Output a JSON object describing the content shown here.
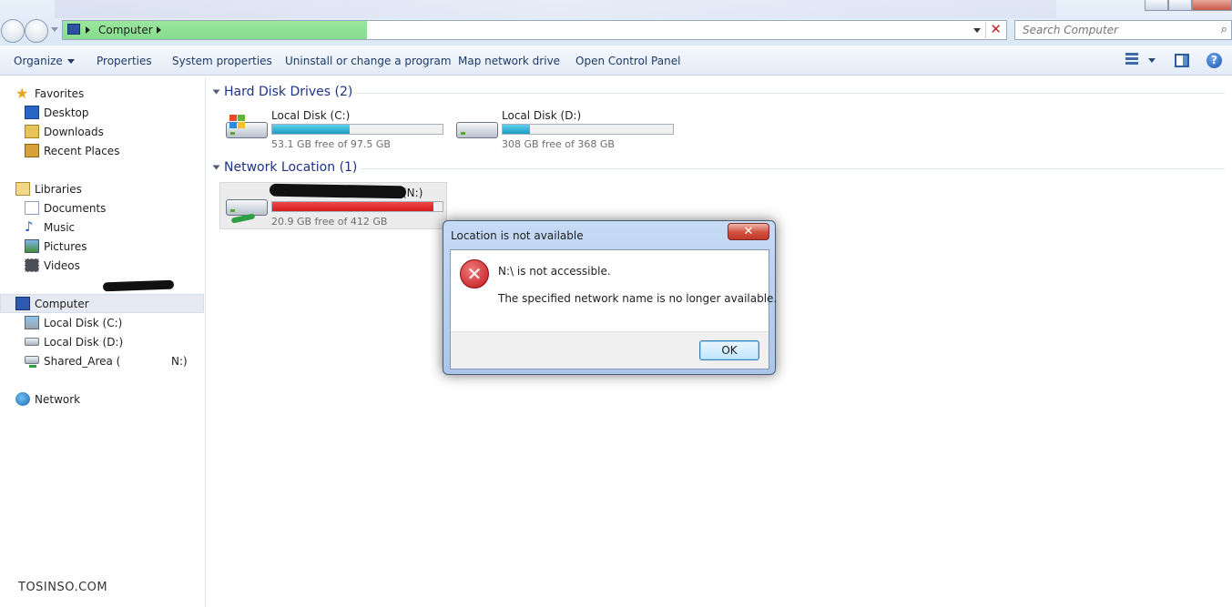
{
  "address_bar": {
    "crumb": "Computer"
  },
  "search": {
    "placeholder": "Search Computer"
  },
  "toolbar": {
    "organize": "Organize",
    "properties": "Properties",
    "system_properties": "System properties",
    "uninstall": "Uninstall or change a program",
    "map_drive": "Map network drive",
    "control_panel": "Open Control Panel"
  },
  "sidebar": {
    "favorites": "Favorites",
    "desktop": "Desktop",
    "downloads": "Downloads",
    "recent": "Recent Places",
    "libraries": "Libraries",
    "documents": "Documents",
    "music": "Music",
    "pictures": "Pictures",
    "videos": "Videos",
    "computer": "Computer",
    "disk_c": "Local Disk (C:)",
    "disk_d": "Local Disk (D:)",
    "shared_prefix": "Shared_Area (",
    "shared_suffix": "N:)",
    "network": "Network"
  },
  "content": {
    "hdd_group": "Hard Disk Drives (2)",
    "net_group": "Network Location (1)",
    "drives": [
      {
        "name": "Local Disk (C:)",
        "free": "53.1 GB free of 97.5 GB",
        "used_fraction": 0.455,
        "color": "#1b9ec3"
      },
      {
        "name": "Local Disk (D:)",
        "free": "308 GB free of 368 GB",
        "used_fraction": 0.163,
        "color": "#1b9ec3"
      }
    ],
    "network_drive": {
      "name_suffix": "(N:)",
      "free": "20.9 GB free of 412 GB",
      "used_fraction": 0.949,
      "color": "#d61c1c"
    }
  },
  "dialog": {
    "title": "Location is not available",
    "close": "✕",
    "message": "N:\\ is not accessible.",
    "detail": "The specified network name is no longer available.",
    "ok": "OK"
  },
  "watermark": "TOSINSO.COM"
}
